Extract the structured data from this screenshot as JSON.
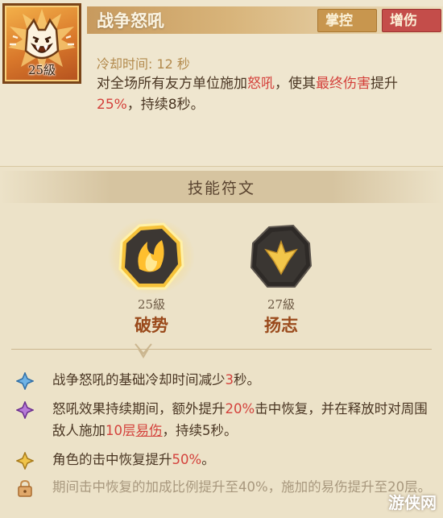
{
  "skill": {
    "level": "25級",
    "title": "战争怒吼",
    "tags": [
      "掌控",
      "增伤"
    ],
    "cooldown": "冷却时间: 12 秒",
    "desc_parts": {
      "p1": "对全场所有友方单位施加",
      "kw_roar": "怒吼",
      "p2": "，使其",
      "kw_final_dmg": "最终伤害",
      "p3": "提升",
      "pct": "25%",
      "p4": "，持续8秒。"
    }
  },
  "runes": {
    "title": "技能符文",
    "items": [
      {
        "level": "25級",
        "name": "破势",
        "selected": true
      },
      {
        "level": "27級",
        "name": "扬志",
        "selected": false
      }
    ]
  },
  "effects": [
    {
      "icon": "blue-diamond-icon",
      "p1": "战争怒吼的基础冷却时间减少",
      "num": "3",
      "p2": "秒。"
    },
    {
      "icon": "purple-diamond-icon",
      "p1": "怒吼效果持续期间，额外提升",
      "pct": "20%",
      "p2": "击中恢复，并在释放时对周围敌人施加",
      "stacks": "10层",
      "kw": "易伤",
      "p3": "，持续5秒。"
    },
    {
      "icon": "gold-diamond-icon",
      "p1": "角色的击中恢复提升",
      "pct": "50%",
      "p2": "。"
    },
    {
      "icon": "lock-icon",
      "locked": true,
      "p1": "期间击中恢复的加成比例提升至40%，施加的易伤提升至20层。"
    }
  ],
  "watermark": "游侠网",
  "colors": {
    "highlight_red": "#d4423c",
    "tag_control": "#c8964e",
    "tag_damage": "#c44d4a",
    "rune_name": "#9a4a1c"
  }
}
